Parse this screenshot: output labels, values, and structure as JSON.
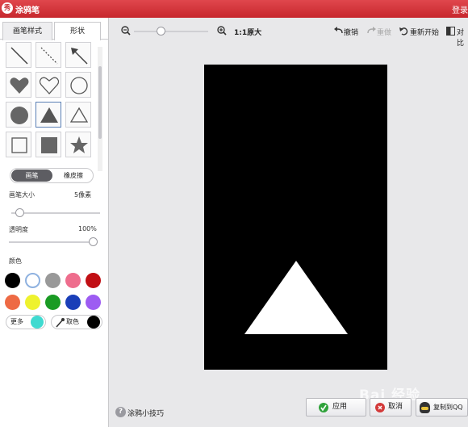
{
  "window": {
    "title": "涂鸦笔",
    "logo_glyph": "秀",
    "login_label": "登录"
  },
  "tabs": [
    {
      "label": "画笔样式"
    },
    {
      "label": "形状"
    }
  ],
  "shapes": [
    "line",
    "dashed-line",
    "arrow",
    "heart-filled",
    "heart-outline",
    "circle-outline",
    "circle-filled",
    "triangle-filled",
    "triangle-outline",
    "square-outline",
    "square-filled",
    "star-filled"
  ],
  "selected_shape": "triangle-filled",
  "mode_toggle": {
    "brush": "画笔",
    "eraser": "橡皮擦"
  },
  "brush_size": {
    "label": "画笔大小",
    "value": "5像素",
    "level": 0.05
  },
  "opacity": {
    "label": "透明度",
    "value": "100%",
    "level": 1.0
  },
  "colors": {
    "label": "颜色",
    "swatches": [
      "#000000",
      "#ffffff",
      "#999999",
      "#ee6d8d",
      "#c10f14",
      "#ee6a44",
      "#eef22e",
      "#1a9b24",
      "#1a3fb8",
      "#9d5cf2"
    ],
    "selected": "#ffffff",
    "more_label": "更多",
    "more_color": "#3fdad0",
    "picker_label": "取色",
    "picker_color": "#000000"
  },
  "toolbar": {
    "zoom_level": 0.35,
    "original_size_label": "1:1原大",
    "undo_label": "撤销",
    "redo_label": "重做",
    "restart_label": "重新开始",
    "compare_label": "对比"
  },
  "canvas": {
    "background": "#000000",
    "shape_color": "#ffffff"
  },
  "bottom": {
    "tips_label": "涂鸦小技巧",
    "apply_label": "应用",
    "cancel_label": "取消",
    "copy_qq_label": "复制到QQ"
  },
  "watermark": "Bai 经验"
}
